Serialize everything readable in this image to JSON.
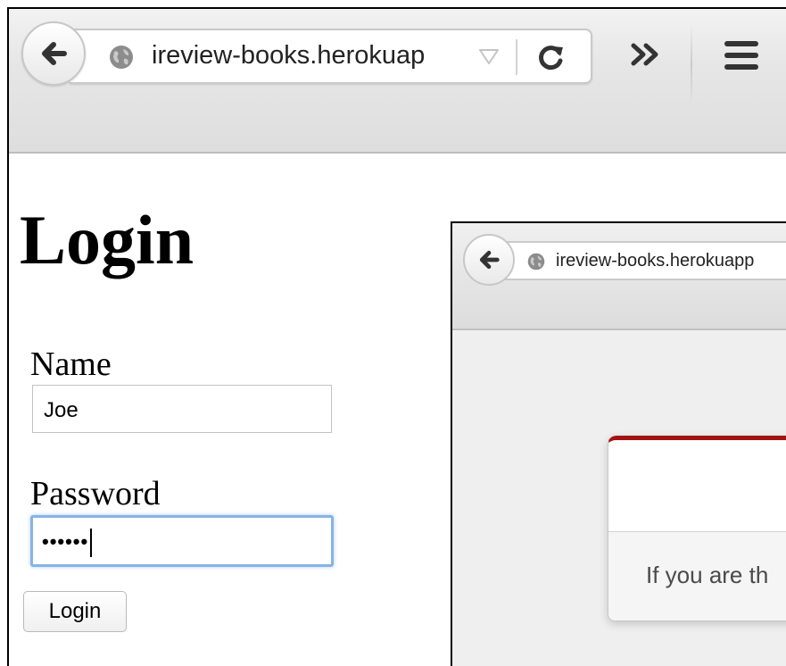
{
  "main_browser": {
    "url": "ireview-books.herokuap",
    "icons": {
      "back": "back-arrow-icon",
      "site": "globe-icon",
      "dropdown": "dropdown-triangle-icon",
      "reload": "reload-icon",
      "overflow": "chevron-double-right-icon",
      "menu": "hamburger-menu-icon"
    }
  },
  "login_form": {
    "title": "Login",
    "name_label": "Name",
    "name_value": "Joe",
    "password_label": "Password",
    "password_masked": "••••••",
    "submit_label": "Login"
  },
  "inset_browser": {
    "url": "ireview-books.herokuapp",
    "dialog_text": "If you are th",
    "colors": {
      "dialog_accent": "#a31212"
    }
  },
  "colors": {
    "focus_ring": "#86b3e8"
  }
}
